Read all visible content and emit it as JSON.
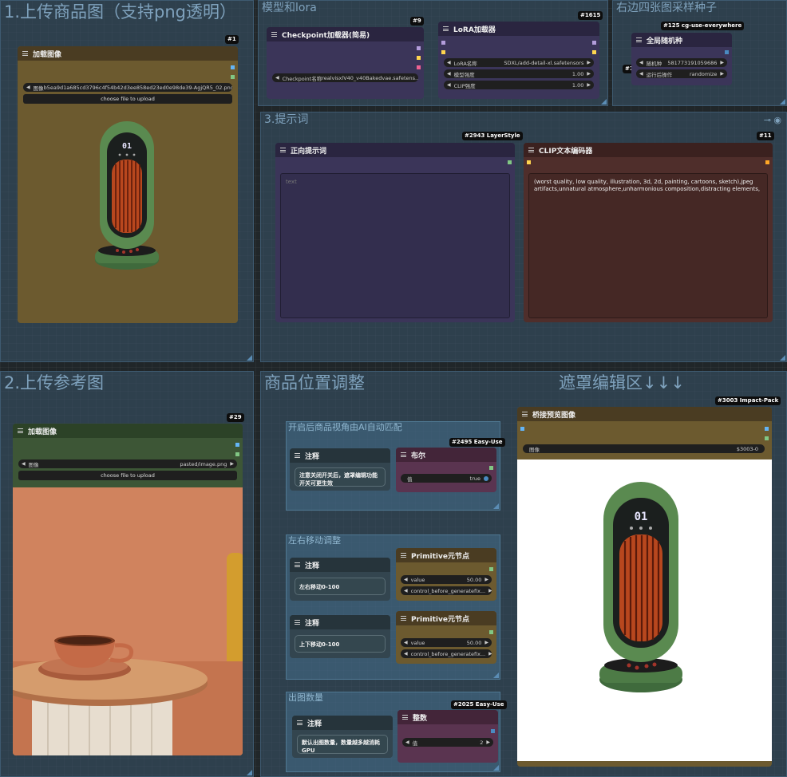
{
  "groups": {
    "upload_product": {
      "title": "1.上传商品图（支持png透明）"
    },
    "model_lora": {
      "title": "模型和lora"
    },
    "seed": {
      "title": "右边四张图采样种子"
    },
    "prompt": {
      "title": "3.提示词"
    },
    "upload_reference": {
      "title": "2.上传参考图"
    },
    "position": {
      "title": "商品位置调整",
      "subtitle": "遮罩编辑区↓↓↓"
    }
  },
  "subgroups": {
    "ai_match": {
      "title": "开启后商品视角由AI自动匹配"
    },
    "lr_move": {
      "title": "左右移动调整"
    },
    "count": {
      "title": "出图数量"
    }
  },
  "nodes": {
    "load_product": {
      "badge": "#1",
      "title": "加载图像",
      "image_label": "图像",
      "image_value": "b5ea9d1a685cd3796c4f54b42d3ee858ed23ed0e98de39-AgjQR5_02.png",
      "upload_label": "choose file to upload"
    },
    "checkpoint": {
      "badge": "#9",
      "title": "Checkpoint加载器(简易)",
      "ckpt_label": "Checkpoint名称",
      "ckpt_value": "realvisxlV40_v40Bakedvae.safetens..."
    },
    "lora": {
      "badge": "#1615",
      "title": "LoRA加载器",
      "lora_label": "LoRA名称",
      "lora_value": "SDXL/add-detail-xl.safetensors",
      "model_label": "模型强度",
      "model_value": "1.00",
      "clip_label": "CLIP强度",
      "clip_value": "1.00"
    },
    "seed": {
      "badge": "#125 cg-use-everywhere",
      "title": "全局随机种",
      "seed_label": "随机种",
      "seed_value": "581773191059686",
      "after_label": "运行后操作",
      "after_value": "randomize",
      "side_badge": "#1"
    },
    "positive": {
      "badge": "#2943 LayerStyle",
      "title": "正向提示词",
      "placeholder": "text"
    },
    "clip_encode": {
      "badge": "#11",
      "title": "CLIP文本编码器",
      "text": "(worst quality, low quality, illustration, 3d, 2d, painting, cartoons, sketch),jpeg artifacts,unnatural atmosphere,unharmonious composition,distracting elements,"
    },
    "load_reference": {
      "badge": "#29",
      "title": "加载图像",
      "image_label": "图像",
      "image_value": "pasted/image.png",
      "upload_label": "choose file to upload"
    },
    "note_ai": {
      "title": "注释",
      "text": "注意关闭开关后，遮罩编辑功能开关可更生效"
    },
    "bool": {
      "badge": "#2495 Easy-Use",
      "title": "布尔",
      "label": "值",
      "value": "true"
    },
    "note_lr": {
      "title": "注释",
      "text": "左右移动0-100"
    },
    "prim_lr": {
      "title": "Primitive元节点",
      "value_label": "value",
      "value": "50.00",
      "cbg_label": "control_before_generate",
      "cbg_value": "fix..."
    },
    "note_ud": {
      "title": "注释",
      "text": "上下移动0-100"
    },
    "prim_ud": {
      "title": "Primitive元节点",
      "value_label": "value",
      "value": "50.00",
      "cbg_label": "control_before_generate",
      "cbg_value": "fix..."
    },
    "note_count": {
      "title": "注释",
      "text": "默认出图数量，数量越多越消耗GPU"
    },
    "int": {
      "badge": "#2025 Easy-Use",
      "title": "整数",
      "label": "值",
      "value": "2"
    },
    "preview": {
      "badge": "#3003 Impact-Pack",
      "title": "桥接预览图像",
      "image_label": "图像",
      "image_value": "$3003-0"
    }
  },
  "heater": {
    "display": "01"
  },
  "colors": {
    "group_bg": "#3a566c",
    "node_brown": "#6c5a2f",
    "node_purple": "#3b3559",
    "node_red": "#4f2e2b",
    "node_green": "#3d5636",
    "node_blue": "#33454f",
    "wall": "#d0835e"
  }
}
